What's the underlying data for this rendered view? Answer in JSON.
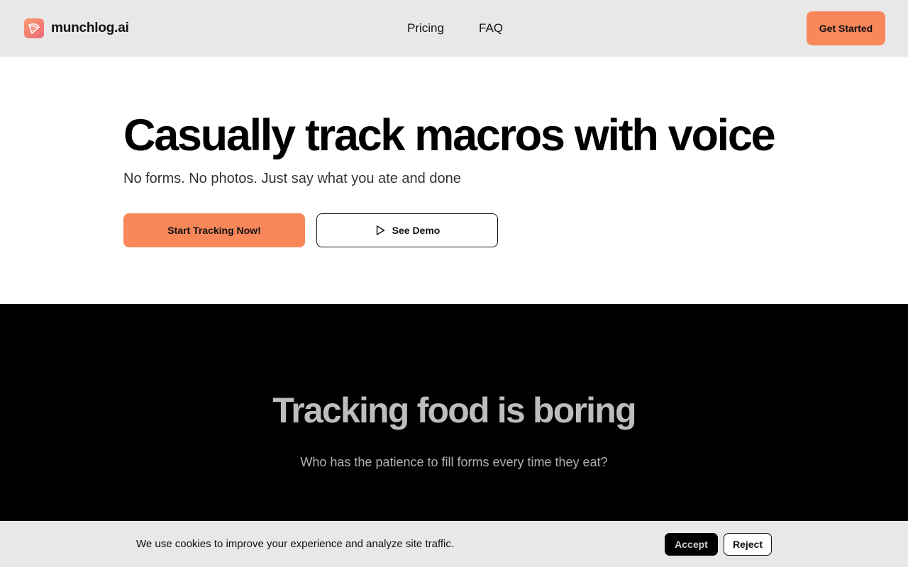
{
  "nav": {
    "logo_icon": "pizza-slice-icon",
    "brand": "munchlog.ai",
    "links": [
      {
        "label": "Pricing"
      },
      {
        "label": "FAQ"
      }
    ],
    "cta_label": "Get Started"
  },
  "hero": {
    "title": "Casually track macros with voice",
    "subtitle": "No forms. No photos. Just say what you ate and done",
    "primary_button": "Start Tracking Now!",
    "secondary_button": "See Demo",
    "secondary_icon": "play-icon"
  },
  "problem": {
    "title": "Tracking food is boring",
    "subtitle": "Who has the patience to fill forms every time they eat?"
  },
  "cookie_banner": {
    "message": "We use cookies to improve your experience and analyze site traffic.",
    "accept_label": "Accept",
    "reject_label": "Reject"
  },
  "colors": {
    "accent": "#f8875a",
    "nav_background": "#e8e8e8",
    "dark_section": "#000000",
    "logo_gradient_start": "#f79a6b",
    "logo_gradient_end": "#f06a79"
  }
}
